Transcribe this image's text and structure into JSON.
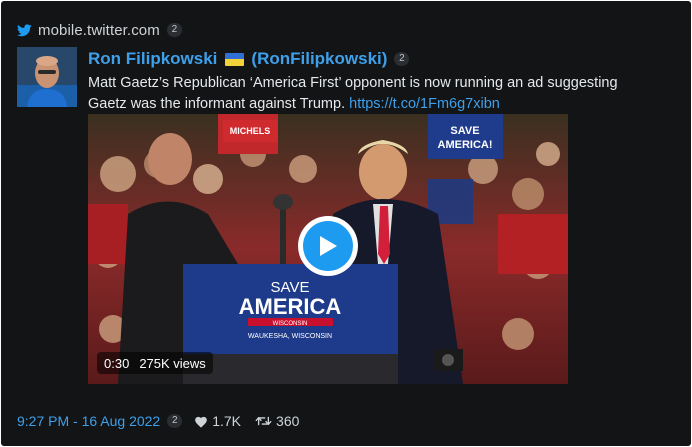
{
  "source": {
    "domain": "mobile.twitter.com",
    "count": "2",
    "icon": "twitter-bird-icon"
  },
  "tweet": {
    "author_name": "Ron Filipkowski",
    "author_handle": "(RonFilipkowski)",
    "author_count": "2",
    "flag": "ukraine-flag-icon",
    "text": "Matt Gaetz’s Republican ‘America First’ opponent is now running an ad suggesting Gaetz was the informant against Trump. ",
    "link": "https://t.co/1Fm6g7xibn"
  },
  "video": {
    "duration": "0:30",
    "views": "275K views",
    "podium_line1": "SAVE",
    "podium_line2": "AMERICA",
    "podium_sub": "WISCONSIN",
    "podium_place": "WAUKESHA, WISCONSIN",
    "sign_text": "SAVE AMERICA!",
    "sign_left": "MICHELS",
    "play_icon": "play-icon"
  },
  "footer": {
    "timestamp": "9:27 PM - 16 Aug 2022",
    "count": "2",
    "likes": "1.7K",
    "retweets": "360"
  },
  "colors": {
    "background": "#121416",
    "accent": "#3ea0ea",
    "play": "#1d9bf0"
  }
}
